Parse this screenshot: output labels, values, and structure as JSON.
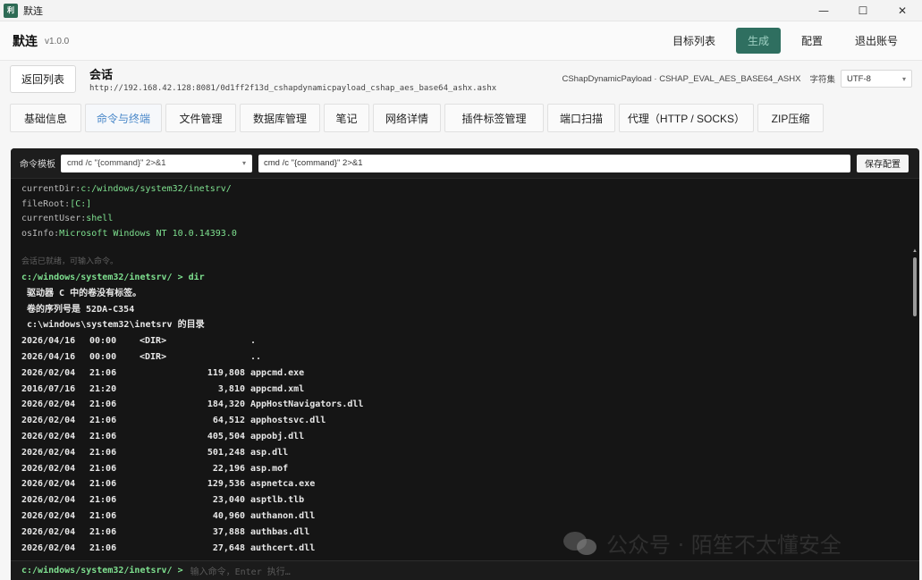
{
  "window": {
    "app_icon_text": "利",
    "title": "默连",
    "controls": {
      "minimize": "—",
      "maximize": "☐",
      "close": "✕"
    }
  },
  "header": {
    "brand": "默连",
    "version": "v1.0.0",
    "nav": {
      "targets": "目标列表",
      "generate": "生成",
      "config": "配置",
      "logout": "退出账号"
    }
  },
  "session": {
    "back_label": "返回列表",
    "title": "会话",
    "url": "http://192.168.42.128:8081/0d1ff2f13d_cshapdynamicpayload_cshap_aes_base64_ashx.ashx",
    "payload": "CShapDynamicPayload · CSHAP_EVAL_AES_BASE64_ASHX",
    "charset_label": "字符集",
    "charset_value": "UTF-8"
  },
  "tabs": [
    {
      "label": "基础信息",
      "active": false
    },
    {
      "label": "命令与终端",
      "active": true
    },
    {
      "label": "文件管理",
      "active": false
    },
    {
      "label": "数据库管理",
      "active": false
    },
    {
      "label": "笔记",
      "active": false
    },
    {
      "label": "网络详情",
      "active": false
    },
    {
      "label": "插件标签管理",
      "active": false
    },
    {
      "label": "端口扫描",
      "active": false
    },
    {
      "label": "代理（HTTP / SOCKS）",
      "active": false
    },
    {
      "label": "ZIP压缩",
      "active": false
    }
  ],
  "terminal": {
    "template_label": "命令模板",
    "template_select": "cmd /c \"{command}\" 2>&1",
    "template_input": "cmd /c \"{command}\" 2>&1",
    "save_label": "保存配置",
    "info": [
      {
        "key": "currentDir:",
        "value": "c:/windows/system32/inetsrv/"
      },
      {
        "key": "fileRoot:",
        "value": "[C:]"
      },
      {
        "key": "currentUser:",
        "value": "shell"
      },
      {
        "key": "osInfo:",
        "value": "Microsoft Windows NT 10.0.14393.0"
      }
    ],
    "ready_hint": "会话已就绪，可输入命令。",
    "prompt": "c:/windows/system32/inetsrv/ > dir",
    "output_lines": [
      " 驱动器 C 中的卷没有标签。",
      " 卷的序列号是 52DA-C354",
      " c:\\windows\\system32\\inetsrv 的目录"
    ],
    "rows": [
      {
        "date": "2026/04/16",
        "time": "00:00",
        "dir": "<DIR>",
        "size": "",
        "name": "."
      },
      {
        "date": "2026/04/16",
        "time": "00:00",
        "dir": "<DIR>",
        "size": "",
        "name": ".."
      },
      {
        "date": "2026/02/04",
        "time": "21:06",
        "dir": "",
        "size": "119,808",
        "name": "appcmd.exe"
      },
      {
        "date": "2016/07/16",
        "time": "21:20",
        "dir": "",
        "size": "3,810",
        "name": "appcmd.xml"
      },
      {
        "date": "2026/02/04",
        "time": "21:06",
        "dir": "",
        "size": "184,320",
        "name": "AppHostNavigators.dll"
      },
      {
        "date": "2026/02/04",
        "time": "21:06",
        "dir": "",
        "size": "64,512",
        "name": "apphostsvc.dll"
      },
      {
        "date": "2026/02/04",
        "time": "21:06",
        "dir": "",
        "size": "405,504",
        "name": "appobj.dll"
      },
      {
        "date": "2026/02/04",
        "time": "21:06",
        "dir": "",
        "size": "501,248",
        "name": "asp.dll"
      },
      {
        "date": "2026/02/04",
        "time": "21:06",
        "dir": "",
        "size": "22,196",
        "name": "asp.mof"
      },
      {
        "date": "2026/02/04",
        "time": "21:06",
        "dir": "",
        "size": "129,536",
        "name": "aspnetca.exe"
      },
      {
        "date": "2026/02/04",
        "time": "21:06",
        "dir": "",
        "size": "23,040",
        "name": "asptlb.tlb"
      },
      {
        "date": "2026/02/04",
        "time": "21:06",
        "dir": "",
        "size": "40,960",
        "name": "authanon.dll"
      },
      {
        "date": "2026/02/04",
        "time": "21:06",
        "dir": "",
        "size": "37,888",
        "name": "authbas.dll"
      },
      {
        "date": "2026/02/04",
        "time": "21:06",
        "dir": "",
        "size": "27,648",
        "name": "authcert.dll"
      }
    ],
    "input_prompt": "c:/windows/system32/inetsrv/ >",
    "input_placeholder": "输入命令，Enter 执行…"
  },
  "watermark": "公众号 · 陌笙不太懂安全",
  "colors": {
    "accent": "#4a88c9",
    "primary_button": "#2f6f60",
    "terminal_bg": "#151515",
    "terminal_green": "#7ee08f"
  }
}
